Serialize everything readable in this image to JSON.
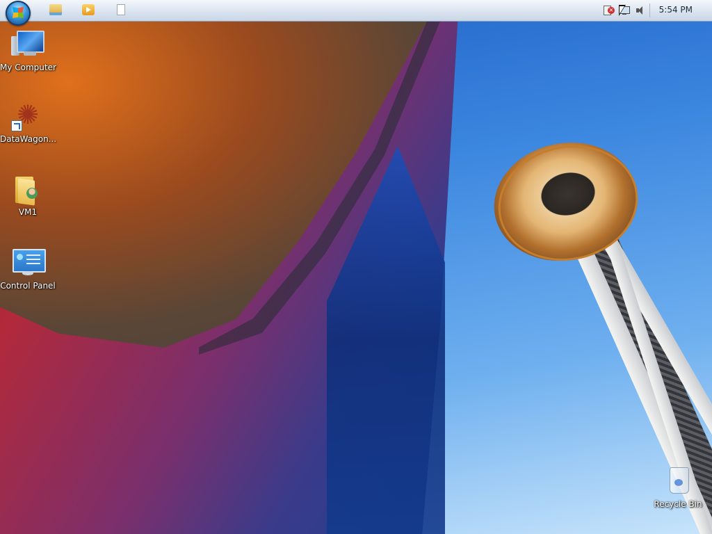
{
  "taskbar": {
    "quick_launch": [
      {
        "name": "Windows Explorer",
        "icon": "folder-explorer-icon"
      },
      {
        "name": "Windows Media Player",
        "icon": "media-player-icon"
      },
      {
        "name": "Blank Document",
        "icon": "document-icon"
      }
    ],
    "tray": {
      "icons": [
        "action-center-flag-icon",
        "network-icon",
        "volume-icon"
      ],
      "clock": "5:54 PM"
    }
  },
  "desktop": {
    "icons": [
      {
        "label": "My Computer",
        "icon": "computer-icon"
      },
      {
        "label": "DataWagon...",
        "icon": "datawagon-shortcut-icon"
      },
      {
        "label": "VM1",
        "icon": "user-folder-icon"
      },
      {
        "label": "Control Panel",
        "icon": "control-panel-icon"
      },
      {
        "label": "Recycle Bin",
        "icon": "recycle-bin-icon"
      }
    ]
  },
  "colors": {
    "taskbar_top": "#f4f7fb",
    "taskbar_bottom": "#c9d6e6",
    "sky": "#3b86df",
    "label_text": "#ffffff"
  }
}
